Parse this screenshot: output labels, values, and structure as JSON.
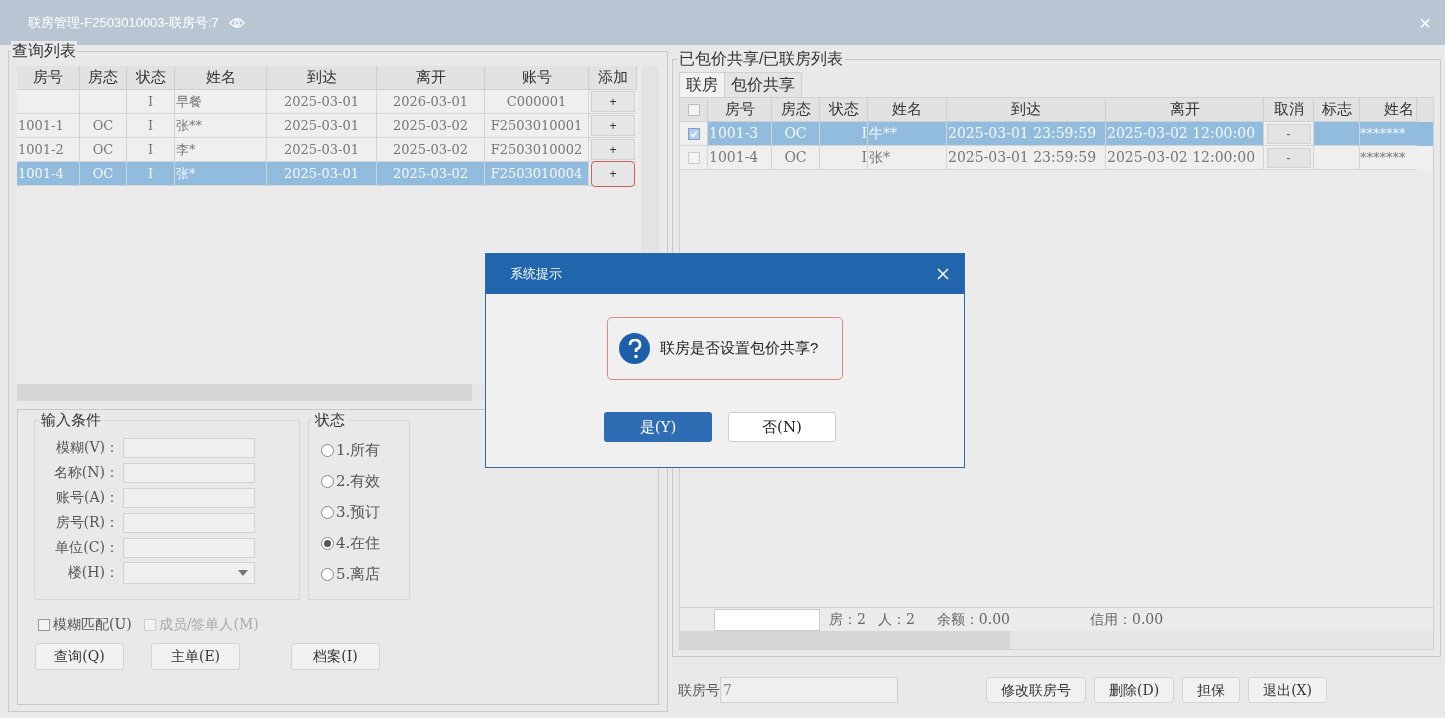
{
  "window": {
    "title": "联房管理-F2503010003-联房号:7",
    "close": "×"
  },
  "query_list": {
    "title": "查询列表",
    "columns": [
      "房号",
      "房态",
      "状态",
      "姓名",
      "到达",
      "离开",
      "账号",
      "添加"
    ],
    "rows": [
      {
        "cells": [
          "",
          "",
          "I",
          "早餐",
          "2025-03-01",
          "2026-03-01",
          "C000001"
        ],
        "add": "+",
        "selected": false,
        "highlighted": false
      },
      {
        "cells": [
          "1001-1",
          "OC",
          "I",
          "张**",
          "2025-03-01",
          "2025-03-02",
          "F2503010001"
        ],
        "add": "+",
        "selected": false,
        "highlighted": false
      },
      {
        "cells": [
          "1001-2",
          "OC",
          "I",
          "李*",
          "2025-03-01",
          "2025-03-02",
          "F2503010002"
        ],
        "add": "+",
        "selected": false,
        "highlighted": false
      },
      {
        "cells": [
          "1001-4",
          "OC",
          "I",
          "张*",
          "2025-03-01",
          "2025-03-02",
          "F2503010004"
        ],
        "add": "+",
        "selected": true,
        "highlighted": true
      }
    ]
  },
  "conditions": {
    "title": "输入条件",
    "fields": [
      {
        "label": "模糊(V)：",
        "kind": "text"
      },
      {
        "label": "名称(N)：",
        "kind": "text"
      },
      {
        "label": "账号(A)：",
        "kind": "text"
      },
      {
        "label": "房号(R)：",
        "kind": "text"
      },
      {
        "label": "单位(C)：",
        "kind": "text"
      },
      {
        "label": "楼(H)：",
        "kind": "dropdown"
      }
    ]
  },
  "status": {
    "title": "状态",
    "options": [
      {
        "label": "1.所有",
        "selected": false
      },
      {
        "label": "2.有效",
        "selected": false
      },
      {
        "label": "3.预订",
        "selected": false
      },
      {
        "label": "4.在住",
        "selected": true
      },
      {
        "label": "5.离店",
        "selected": false
      }
    ]
  },
  "checkboxes": [
    {
      "label": "模糊匹配(U)",
      "checked": false,
      "disabled": false
    },
    {
      "label": "成员/签单人(M)",
      "checked": false,
      "disabled": true
    }
  ],
  "left_buttons": [
    "查询(Q)",
    "主单(E)",
    "档案(I)"
  ],
  "linked_list": {
    "title": "已包价共享/已联房列表",
    "header_checked": false,
    "tabs": [
      {
        "label": "联房",
        "selected": true
      },
      {
        "label": "包价共享",
        "selected": false
      }
    ],
    "columns": [
      "房号",
      "房态",
      "状态",
      "姓名",
      "到达",
      "离开",
      "取消",
      "标志",
      "姓名"
    ],
    "rows": [
      {
        "checked": true,
        "selected": true,
        "cells": [
          "1001-3",
          "OC",
          "I",
          "牛**",
          "2025-03-01 23:59:59",
          "2025-03-02 12:00:00"
        ],
        "cancel": "-",
        "name2": "*******"
      },
      {
        "checked": false,
        "selected": false,
        "cells": [
          "1001-4",
          "OC",
          "I",
          "张*",
          "2025-03-01 23:59:59",
          "2025-03-02 12:00:00"
        ],
        "cancel": "-",
        "name2": "*******"
      }
    ],
    "summary": [
      "房：2",
      "人：2",
      "余额：0.00",
      "信用：0.00"
    ]
  },
  "link_no": {
    "label": "联房号",
    "value": "7"
  },
  "bottom_buttons": [
    "修改联房号",
    "删除(D)",
    "担保",
    "退出(X)"
  ],
  "dialog": {
    "title": "系统提示",
    "message": "联房是否设置包价共享?",
    "buttons": [
      {
        "label": "是(Y)",
        "default": true
      },
      {
        "label": "否(N)",
        "default": false
      }
    ]
  }
}
